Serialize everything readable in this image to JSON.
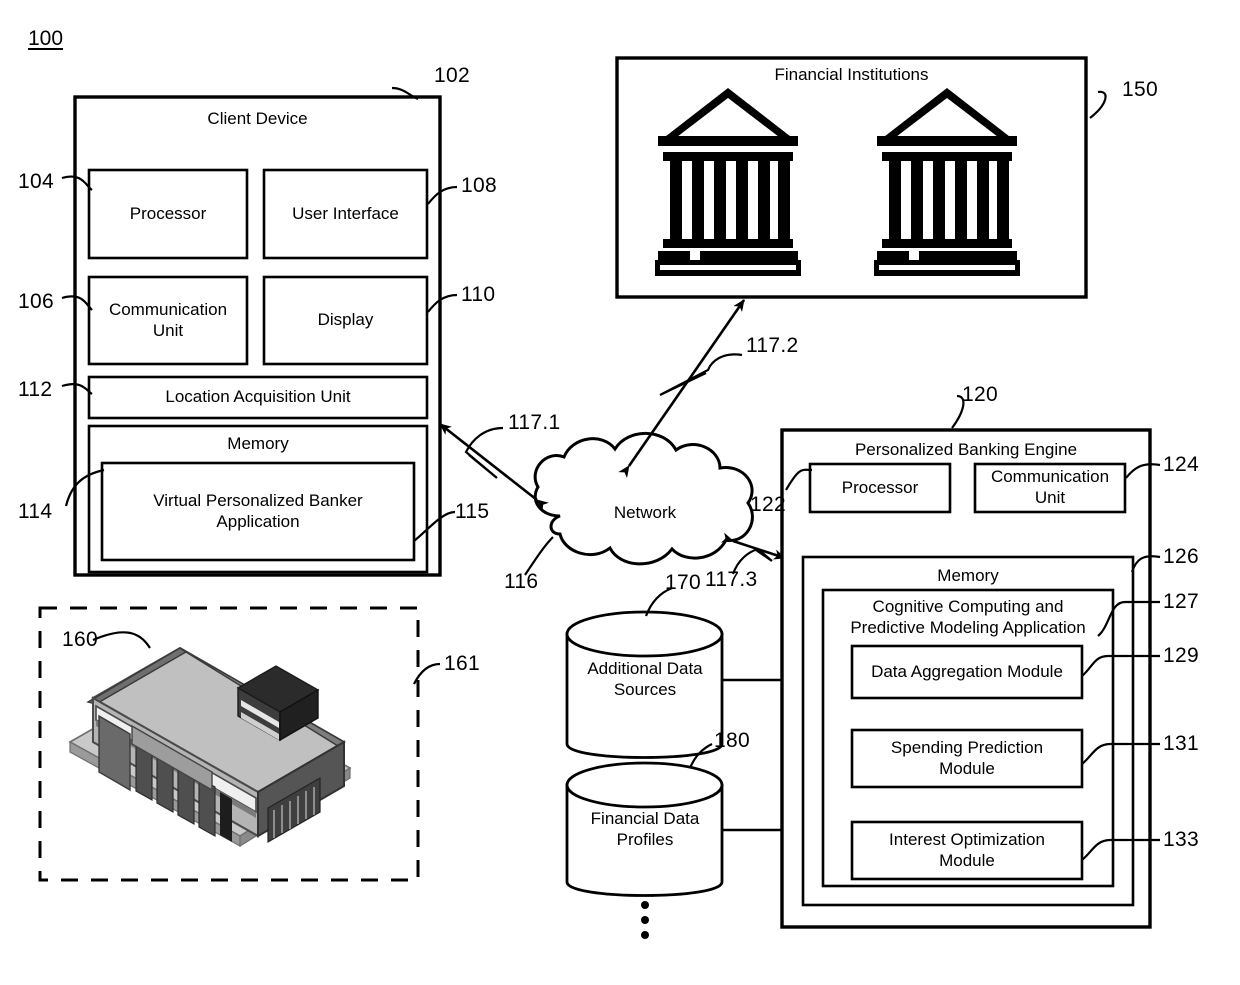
{
  "figure": {
    "number": "100",
    "type": "patent-system-block-diagram"
  },
  "client_device": {
    "title": "Client Device",
    "ref": "102",
    "components": [
      {
        "label": "Processor",
        "ref": "104"
      },
      {
        "label": "User Interface",
        "ref": "108"
      },
      {
        "label": "Communication\nUnit",
        "ref": "106"
      },
      {
        "label": "Display",
        "ref": "110"
      },
      {
        "label": "Location Acquisition Unit",
        "ref": "112"
      }
    ],
    "memory": {
      "label": "Memory",
      "ref": "114",
      "application": {
        "label": "Virtual Personalized Banker\nApplication",
        "ref": "115"
      }
    }
  },
  "financial_institutions": {
    "title": "Financial Institutions",
    "ref": "150",
    "icons": [
      "bank-building-icon",
      "bank-building-icon"
    ]
  },
  "network": {
    "label": "Network",
    "ref": "116"
  },
  "links": [
    {
      "label": "117.1",
      "from": "client-device",
      "to": "network"
    },
    {
      "label": "117.2",
      "from": "network",
      "to": "financial-institutions"
    },
    {
      "label": "117.3",
      "from": "network",
      "to": "personalized-banking-engine"
    }
  ],
  "branch": {
    "ref_building": "160",
    "ref_region": "161",
    "icon": "retail-branch-building-3d-icon"
  },
  "datastores": [
    {
      "label": "Additional Data\nSources",
      "ref": "170"
    },
    {
      "label": "Financial Data\nProfiles",
      "ref": "180"
    }
  ],
  "datastore_more_indicator": "vertical-ellipsis",
  "banking_engine": {
    "title": "Personalized Banking Engine",
    "ref": "120",
    "components": [
      {
        "label": "Processor",
        "ref": "122"
      },
      {
        "label": "Communication\nUnit",
        "ref": "124"
      }
    ],
    "memory": {
      "label": "Memory",
      "ref": "126",
      "application": {
        "label": "Cognitive Computing and\nPredictive Modeling Application",
        "ref": "127",
        "modules": [
          {
            "label": "Data Aggregation Module",
            "ref": "129"
          },
          {
            "label": "Spending Prediction\nModule",
            "ref": "131"
          },
          {
            "label": "Interest Optimization\nModule",
            "ref": "133"
          }
        ]
      }
    }
  },
  "colors": {
    "ink": "#000000",
    "paper": "#ffffff",
    "building_light": "#d8d8d8",
    "building_mid": "#a8a8a8",
    "building_dark": "#6e6e6e",
    "building_darkest": "#3a3a3a"
  }
}
